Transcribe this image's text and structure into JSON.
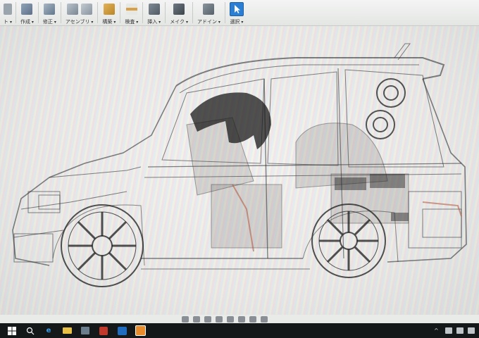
{
  "ribbon": {
    "groups": [
      {
        "label": "作成",
        "icons": [
          "cube-icon"
        ]
      },
      {
        "label": "修正",
        "icons": [
          "modify-icon"
        ]
      },
      {
        "label": "アセンブリ",
        "icons": [
          "assembly-icon",
          "joint-icon"
        ]
      },
      {
        "label": "構築",
        "icons": [
          "plane-icon"
        ]
      },
      {
        "label": "検査",
        "icons": [
          "measure-icon"
        ]
      },
      {
        "label": "挿入",
        "icons": [
          "insert-image-icon"
        ]
      },
      {
        "label": "メイク",
        "icons": [
          "make-icon"
        ]
      },
      {
        "label": "アドイン",
        "icons": [
          "addin-icon"
        ]
      },
      {
        "label": "選択",
        "icons": [
          "select-arrow-icon"
        ]
      }
    ],
    "left_stub_label": "ト",
    "accent": "#2a7fd4"
  },
  "canvas": {
    "model": "transparent-wireframe-car",
    "bg": "#ecedeb"
  },
  "navbar": {
    "icons": [
      "orbit-icon",
      "look-at-icon",
      "pan-icon",
      "zoom-icon",
      "fit-icon",
      "display-settings-icon",
      "grid-icon",
      "viewports-icon"
    ]
  },
  "taskbar": {
    "items": [
      "start-icon",
      "search-icon",
      "edge-icon",
      "file-explorer-icon",
      "store-icon",
      "security-icon",
      "outlook-icon",
      "fusion-app-icon"
    ],
    "tray": [
      "chevron-up-icon",
      "network-icon",
      "volume-icon",
      "notification-icon"
    ]
  }
}
